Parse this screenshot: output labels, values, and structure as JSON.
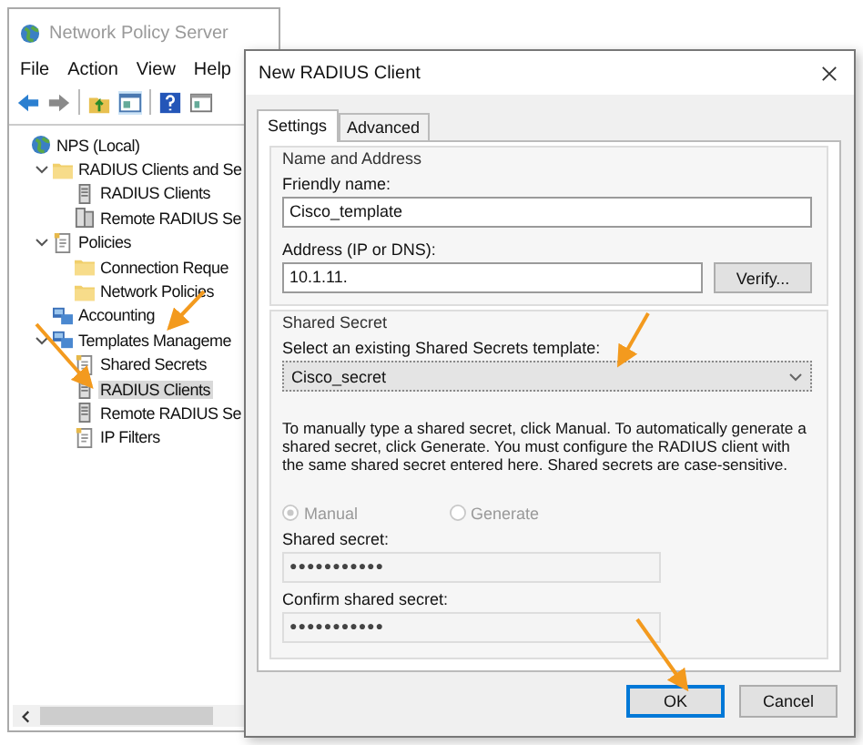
{
  "main_window": {
    "title": "Network Policy Server",
    "menu": [
      "File",
      "Action",
      "View",
      "Help"
    ],
    "toolbar": [
      {
        "kind": "back"
      },
      {
        "kind": "forward"
      },
      {
        "kind": "up"
      },
      {
        "kind": "console"
      },
      {
        "kind": "help"
      },
      {
        "kind": "pane"
      }
    ],
    "tree": [
      {
        "label": "NPS (Local)",
        "kind": "root",
        "selected": false,
        "children": [
          {
            "label": "RADIUS Clients and Se",
            "kind": "folder",
            "expanded": true,
            "selected": false,
            "children": [
              {
                "label": "RADIUS Clients",
                "kind": "server",
                "selected": false
              },
              {
                "label": "Remote RADIUS Se",
                "kind": "server-group",
                "selected": false
              }
            ]
          },
          {
            "label": "Policies",
            "kind": "document",
            "expanded": true,
            "selected": false,
            "children": [
              {
                "label": "Connection Reque",
                "kind": "folder",
                "selected": false
              },
              {
                "label": "Network Policies",
                "kind": "folder",
                "selected": false
              }
            ]
          },
          {
            "label": "Accounting",
            "kind": "console",
            "selected": false
          },
          {
            "label": "Templates Manageme",
            "kind": "console",
            "expanded": true,
            "selected": false,
            "children": [
              {
                "label": "Shared Secrets",
                "kind": "document",
                "selected": false
              },
              {
                "label": "RADIUS Clients",
                "kind": "server",
                "selected": true
              },
              {
                "label": "Remote RADIUS Se",
                "kind": "server",
                "selected": false
              },
              {
                "label": "IP Filters",
                "kind": "document",
                "selected": false
              }
            ]
          }
        ]
      }
    ]
  },
  "dialog": {
    "title": "New RADIUS Client",
    "tabs": [
      {
        "label": "Settings",
        "selected": true
      },
      {
        "label": "Advanced",
        "selected": false
      }
    ],
    "name_group": {
      "title": "Name and Address",
      "friendly_label": "Friendly name:",
      "friendly_value": "Cisco_template",
      "address_label": "Address (IP or DNS):",
      "address_value": "10.1.11.",
      "verify_button": "Verify..."
    },
    "secret_group": {
      "title": "Shared Secret",
      "template_label": "Select an existing Shared Secrets template:",
      "template_value": "Cisco_secret",
      "info": "To manually type a shared secret, click Manual. To automatically generate a shared secret, click Generate. You must configure the RADIUS client with the same shared secret entered here. Shared secrets are case-sensitive.",
      "radios": [
        {
          "label": "Manual",
          "selected": true,
          "disabled": true
        },
        {
          "label": "Generate",
          "selected": false,
          "disabled": true
        }
      ],
      "fields": [
        {
          "label": "Shared secret:",
          "value": "●●●●●●●●●●●",
          "disabled": true
        },
        {
          "label": "Confirm shared secret:",
          "value": "●●●●●●●●●●●",
          "disabled": true
        }
      ]
    },
    "buttons": [
      {
        "label": "OK",
        "default": true
      },
      {
        "label": "Cancel",
        "default": false
      }
    ]
  }
}
